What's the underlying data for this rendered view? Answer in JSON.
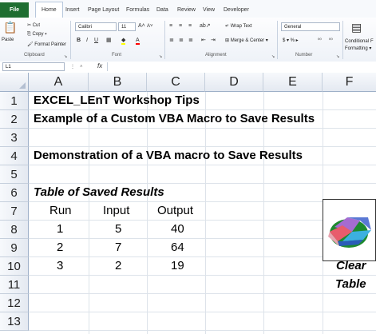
{
  "ribbon": {
    "tabs": [
      "File",
      "Home",
      "Insert",
      "Page Layout",
      "Formulas",
      "Data",
      "Review",
      "View",
      "Developer"
    ],
    "clipboard": {
      "paste": "Paste",
      "cut": "Cut",
      "copy": "Copy ▾",
      "format_painter": "Format Painter",
      "label": "Clipboard"
    },
    "font": {
      "name": "Calibri",
      "size": "11",
      "label": "Font"
    },
    "alignment": {
      "wrap_text": "Wrap Text",
      "merge_center": "Merge & Center ▾",
      "label": "Alignment"
    },
    "number": {
      "format": "General",
      "currency": "$ ▾ % ▸",
      "label": "Number"
    },
    "styles": {
      "conditional": "Conditional",
      "formatting": "Formatting ▾",
      "f": "F"
    }
  },
  "formula_bar": {
    "name_box": "L1",
    "fx": "fx"
  },
  "grid": {
    "columns": [
      "A",
      "B",
      "C",
      "D",
      "E",
      "F"
    ],
    "rows": [
      "1",
      "2",
      "3",
      "4",
      "5",
      "6",
      "7",
      "8",
      "9",
      "10",
      "11",
      "12",
      "13"
    ],
    "cells": {
      "a1": "EXCEL_LEnT Workshop Tips",
      "a2": "Example of a Custom VBA Macro to Save Results",
      "a4": "Demonstration of a VBA macro to Save Results",
      "a6": "Table of Saved Results",
      "a7": "Run",
      "b7": "Input",
      "c7": "Output",
      "a8": "1",
      "b8": "5",
      "c8": "40",
      "a9": "2",
      "b9": "7",
      "c9": "64",
      "a10": "3",
      "b10": "2",
      "c10": "19",
      "f10": "Clear",
      "f11": "Table"
    }
  },
  "colors": {
    "file_tab": "#1f6e31",
    "grid_line": "#dde3ea",
    "header_bg": "#e4e9f1"
  }
}
